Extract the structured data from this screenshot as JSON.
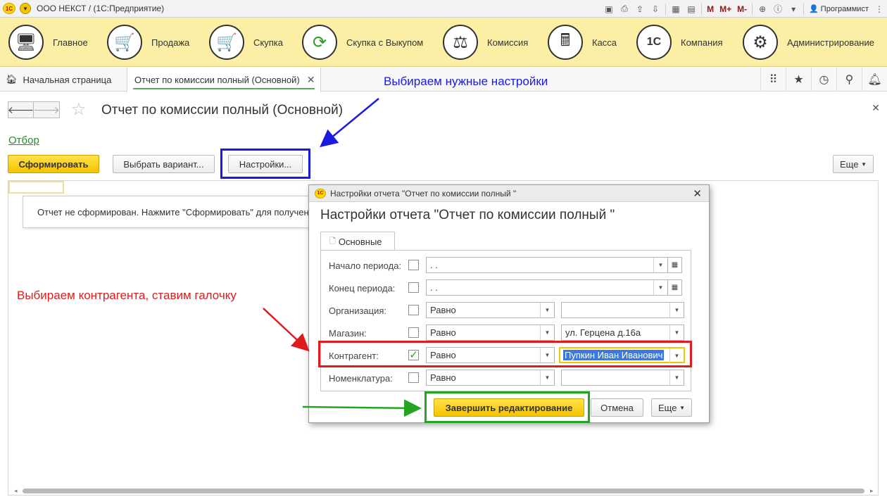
{
  "titlebar": {
    "logo": "1С",
    "title": "ООО НЕКСТ / (1С:Предприятие)",
    "m": "M",
    "m_plus": "M+",
    "m_minus": "M-",
    "user": "Программист"
  },
  "sections": [
    {
      "label": "Главное",
      "icon": "computer-icon"
    },
    {
      "label": "Продажа",
      "icon": "cart-up-icon"
    },
    {
      "label": "Скупка",
      "icon": "cart-down-icon"
    },
    {
      "label": "Скупка с Выкупом",
      "icon": "cycle-arrows-icon"
    },
    {
      "label": "Комиссия",
      "icon": "scales-icon"
    },
    {
      "label": "Касса",
      "icon": "cash-register-icon"
    },
    {
      "label": "Компания",
      "icon": "1c-company-icon"
    },
    {
      "label": "Администрирование",
      "icon": "gears-icon"
    }
  ],
  "tabs": {
    "home": "Начальная страница",
    "active": "Отчет по комиссии полный (Основной)"
  },
  "annotations": {
    "blue": "Выбираем нужные настройки",
    "red": "Выбираем контрагента, ставим галочку"
  },
  "page": {
    "title": "Отчет по комиссии полный (Основной)",
    "otbor": "Отбор",
    "btn_generate": "Сформировать",
    "btn_variant": "Выбрать вариант...",
    "btn_settings": "Настройки...",
    "btn_more": "Еще",
    "notice": "Отчет не сформирован. Нажмите \"Сформировать\" для получения отчета"
  },
  "dialog": {
    "window_title": "Настройки отчета \"Отчет по комиссии полный \"",
    "heading": "Настройки отчета \"Отчет по комиссии полный \"",
    "tab": "Основные",
    "rows": [
      {
        "label": "Начало периода:",
        "value": " .  .",
        "checked": false
      },
      {
        "label": "Конец периода:",
        "value": " .  .",
        "checked": false
      },
      {
        "label": "Организация:",
        "condition": "Равно",
        "value": "",
        "checked": false
      },
      {
        "label": "Магазин:",
        "condition": "Равно",
        "value": "ул. Герцена д.16а",
        "checked": false
      },
      {
        "label": "Контрагент:",
        "condition": "Равно",
        "value": "Пупкин Иван Иванович",
        "checked": true
      },
      {
        "label": "Номенклатура:",
        "condition": "Равно",
        "value": "",
        "checked": false
      }
    ],
    "btn_finish": "Завершить редактирование",
    "btn_cancel": "Отмена",
    "btn_more": "Еще"
  },
  "colors": {
    "section_bg": "#fbeea5",
    "primary_button": "#f4c400",
    "highlight_blue": "#1a1ae0",
    "highlight_red": "#e01b1b",
    "highlight_green": "#22a622",
    "link_green": "#2d8a2d"
  }
}
